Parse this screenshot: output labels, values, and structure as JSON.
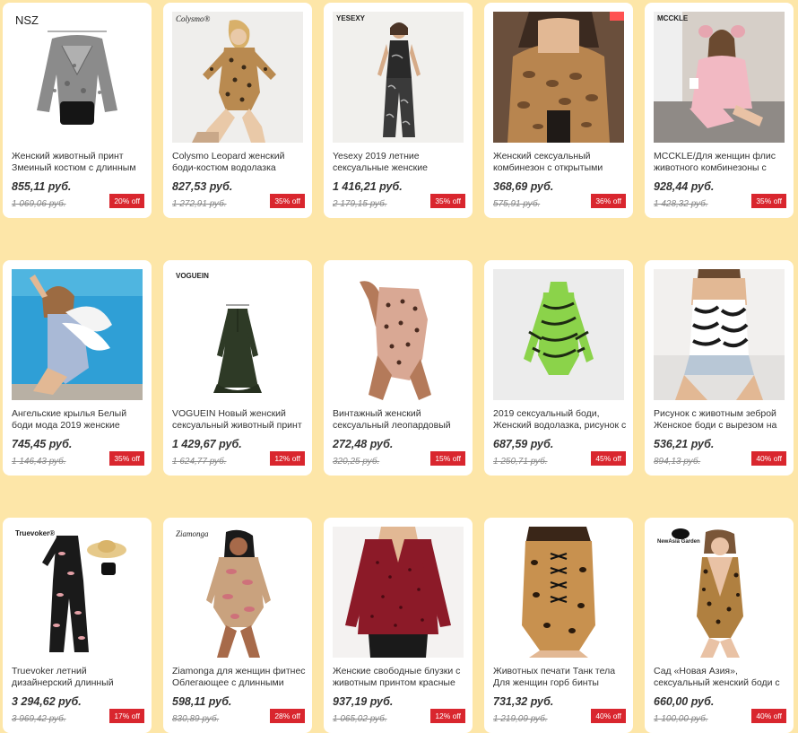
{
  "colors": {
    "page_bg": "#fde6a8",
    "card_bg": "#ffffff",
    "badge_bg": "#d9262e"
  },
  "products": [
    {
      "brand": "NSZ",
      "title": "Женский животный принт Змеиный костюм с длинным",
      "price": "855,11 руб.",
      "old_price": "1 069,06 руб.",
      "discount": "20% off",
      "art": "snake-silver"
    },
    {
      "brand": "Colysmo®",
      "title": "Colysmo Leopard женский боди-костюм водолазка",
      "price": "827,53 руб.",
      "old_price": "1 272,91 руб.",
      "discount": "35% off",
      "art": "leopard-bodysuit"
    },
    {
      "brand": "YESEXY",
      "title": "Yesexy 2019 летние сексуальные женские",
      "price": "1 416,21 руб.",
      "old_price": "2 179,15 руб.",
      "discount": "35% off",
      "art": "jumpsuit"
    },
    {
      "brand": "",
      "title": "Женский сексуальный комбинезон с открытыми",
      "price": "368,69 руб.",
      "old_price": "575,91 руб.",
      "discount": "36% off",
      "art": "snake-brown"
    },
    {
      "brand": "MCCKLE",
      "title": "MCCKLE/Для женщин флис животного комбинезоны с",
      "price": "928,44 руб.",
      "old_price": "1 428,32 руб.",
      "discount": "35% off",
      "art": "pink-fleece"
    },
    {
      "brand": "",
      "title": "Ангельские крылья Белый боди мода 2019 женские",
      "price": "745,45 руб.",
      "old_price": "1 146,43 руб.",
      "discount": "35% off",
      "art": "angel-pool"
    },
    {
      "brand": "VOGUEIN",
      "title": "VOGUEIN Новый женский сексуальный животный принт",
      "price": "1 429,67 руб.",
      "old_price": "1 624,77 руб.",
      "discount": "12% off",
      "art": "green-dress"
    },
    {
      "brand": "",
      "title": "Винтажный женский сексуальный леопардовый",
      "price": "272,48 руб.",
      "old_price": "320,25 руб.",
      "discount": "15% off",
      "art": "swimsuit"
    },
    {
      "brand": "",
      "title": "2019 сексуальный боди, Женский водолазка, рисунок с",
      "price": "687,59 руб.",
      "old_price": "1 250,71 руб.",
      "discount": "45% off",
      "art": "zebra-green"
    },
    {
      "brand": "",
      "title": "Рисунок с животным зеброй Женское боди с вырезом на",
      "price": "536,21 руб.",
      "old_price": "894,13 руб.",
      "discount": "40% off",
      "art": "zebra-top"
    },
    {
      "brand": "Truevoker®",
      "title": "Truevoker летний дизайнерский длинный",
      "price": "3 294,62 руб.",
      "old_price": "3 969,42 руб.",
      "discount": "17% off",
      "art": "floral-jumpsuit"
    },
    {
      "brand": "Ziamonga",
      "title": "Ziamonga для женщин фитнес Облегающее с длинными",
      "price": "598,11 руб.",
      "old_price": "830,89 руб.",
      "discount": "28% off",
      "art": "snake-mesh"
    },
    {
      "brand": "",
      "title": "Женские свободные блузки с животным принтом красные",
      "price": "937,19 руб.",
      "old_price": "1 065,02 руб.",
      "discount": "12% off",
      "art": "red-blouse"
    },
    {
      "brand": "",
      "title": "Животных печати Танк тела Для женщин горб бинты",
      "price": "731,32 руб.",
      "old_price": "1 219,09 руб.",
      "discount": "40% off",
      "art": "leopard-lace"
    },
    {
      "brand": "NewAsia Garden",
      "title": "Сад «Новая Азия», сексуальный женский боди с v-",
      "price": "660,00 руб.",
      "old_price": "1 100,00 руб.",
      "discount": "40% off",
      "art": "leopard-v"
    }
  ]
}
